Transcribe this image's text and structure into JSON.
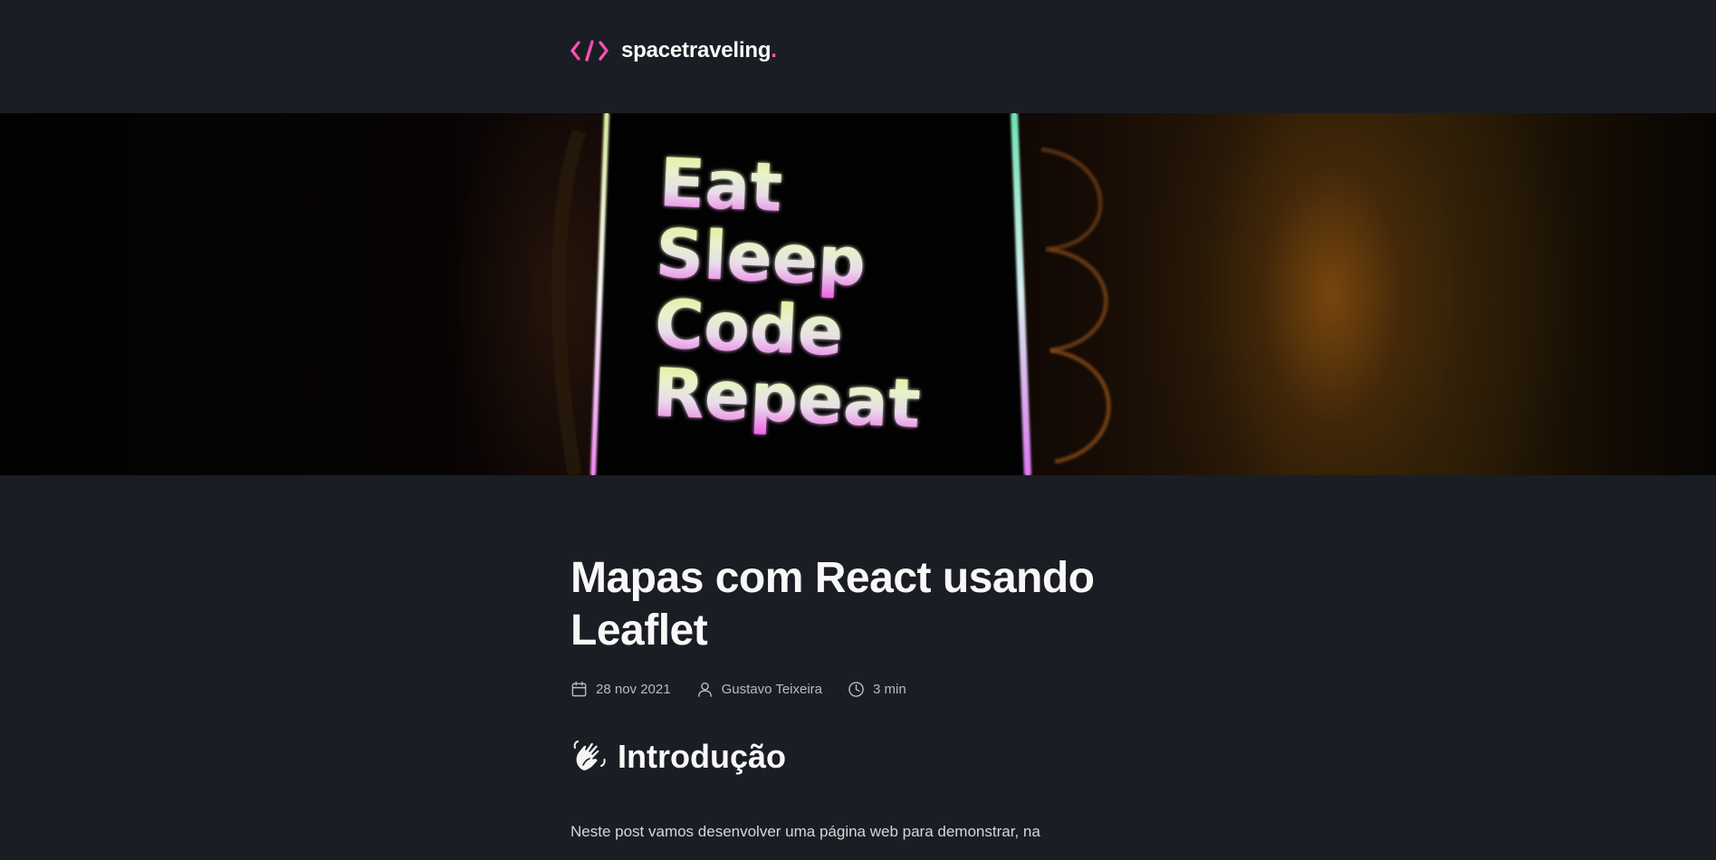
{
  "header": {
    "logo_icon": "code-brackets-icon",
    "logo_text": "spacetraveling",
    "logo_dot": ".",
    "accent_color": "#ff57b2"
  },
  "banner": {
    "lines": [
      "Eat",
      "Sleep",
      "Code",
      "Repeat"
    ]
  },
  "post": {
    "title": "Mapas com React usando Leaflet",
    "date": "28 nov 2021",
    "date_icon": "calendar-icon",
    "author": "Gustavo Teixeira",
    "author_icon": "user-icon",
    "reading_time": "3 min",
    "reading_time_icon": "clock-icon",
    "section_icon": "waving-hand-icon",
    "section_heading": "Introdução",
    "paragraph": "Neste post vamos desenvolver uma página web para demonstrar, na"
  },
  "colors": {
    "background": "#1a1d23",
    "text": "#f8f8f8",
    "muted": "#bbbbbb"
  }
}
